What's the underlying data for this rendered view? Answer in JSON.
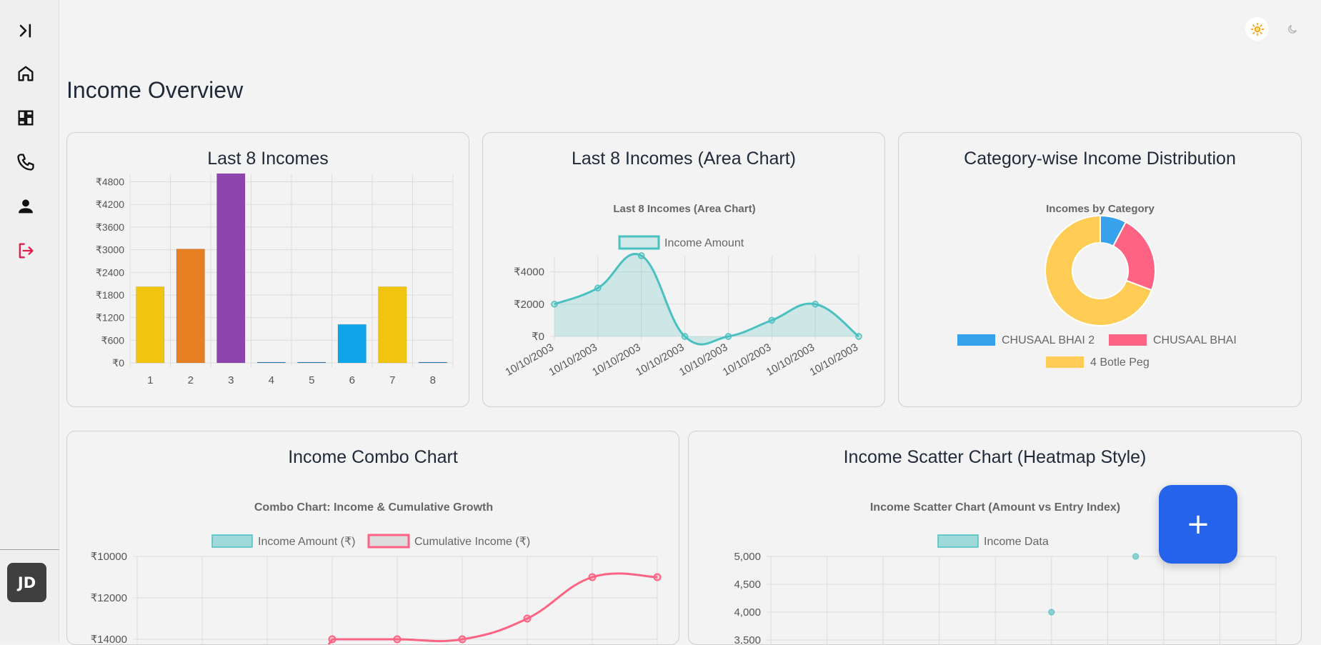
{
  "sidebar": {
    "items": [
      {
        "name": "expand-sidebar-icon"
      },
      {
        "name": "home-icon"
      },
      {
        "name": "dashboard-icon"
      },
      {
        "name": "phone-icon"
      },
      {
        "name": "user-icon"
      },
      {
        "name": "logout-icon",
        "color": "#e11d48"
      }
    ],
    "avatar_initials": "JD"
  },
  "topbar": {
    "light_mode_icon": "sun-icon",
    "dark_mode_icon": "moon-icon"
  },
  "page": {
    "title": "Income Overview"
  },
  "fab": {
    "label": "+",
    "color": "#2563eb"
  },
  "cards": {
    "bar": {
      "title": "Last 8 Incomes"
    },
    "area": {
      "title": "Last 8 Incomes (Area Chart)"
    },
    "donut": {
      "title": "Category-wise Income Distribution"
    },
    "combo": {
      "title": "Income Combo Chart"
    },
    "scatter": {
      "title": "Income Scatter Chart (Heatmap Style)"
    }
  },
  "chart_data": [
    {
      "id": "bar",
      "type": "bar",
      "categories": [
        "1",
        "2",
        "3",
        "4",
        "5",
        "6",
        "7",
        "8"
      ],
      "values": [
        2000,
        3000,
        5000,
        0,
        0,
        1000,
        2000,
        0
      ],
      "colors": [
        "#f1c40f",
        "#e67e22",
        "#8e44ad",
        "#2980b9",
        "#2980b9",
        "#0ea5e9",
        "#f1c40f",
        "#2980b9"
      ],
      "yticks": [
        "₹0",
        "₹600",
        "₹1200",
        "₹1800",
        "₹2400",
        "₹3000",
        "₹3600",
        "₹4200",
        "₹4800"
      ],
      "ylim": [
        0,
        5000
      ]
    },
    {
      "id": "area",
      "type": "area",
      "title": "Last 8 Incomes (Area Chart)",
      "series": [
        {
          "name": "Income Amount",
          "values": [
            2000,
            3000,
            5000,
            0,
            0,
            1000,
            2000,
            0
          ],
          "color": "#4bc0c0"
        }
      ],
      "categories": [
        "10/10/2003",
        "10/10/2003",
        "10/10/2003",
        "10/10/2003",
        "10/10/2003",
        "10/10/2003",
        "10/10/2003",
        "10/10/2003"
      ],
      "yticks": [
        "₹0",
        "₹2000",
        "₹4000"
      ],
      "ylim": [
        0,
        5000
      ]
    },
    {
      "id": "donut",
      "type": "pie",
      "title": "Incomes by Category",
      "slices": [
        {
          "label": "CHUSAAL BHAI 2",
          "value": 1000,
          "color": "#36a2eb"
        },
        {
          "label": "CHUSAAL BHAI",
          "value": 3000,
          "color": "#ff6384"
        },
        {
          "label": "4 Botle Peg",
          "value": 9000,
          "color": "#ffcd56"
        }
      ]
    },
    {
      "id": "combo",
      "type": "line",
      "title": "Combo Chart: Income & Cumulative Growth",
      "series": [
        {
          "name": "Income Amount (₹)",
          "color": "#4bc0c0"
        },
        {
          "name": "Cumulative Income (₹)",
          "color": "#ff6384",
          "values": [
            null,
            null,
            null,
            10000,
            10000,
            10000,
            11000,
            13000,
            13000
          ]
        }
      ],
      "yticks": [
        "₹10000",
        "₹12000",
        "₹14000"
      ],
      "ylim": [
        10000,
        14000
      ]
    },
    {
      "id": "scatter",
      "type": "scatter",
      "title": "Income Scatter Chart (Amount vs Entry Index)",
      "series": [
        {
          "name": "Income Data",
          "color": "#4bc0c0",
          "points": [
            {
              "x": 5,
              "y": 4000
            },
            {
              "x": 6.5,
              "y": 5000
            }
          ]
        }
      ],
      "yticks": [
        "3,500",
        "4,000",
        "4,500",
        "5,000"
      ],
      "ylim": [
        3500,
        5000
      ]
    }
  ]
}
